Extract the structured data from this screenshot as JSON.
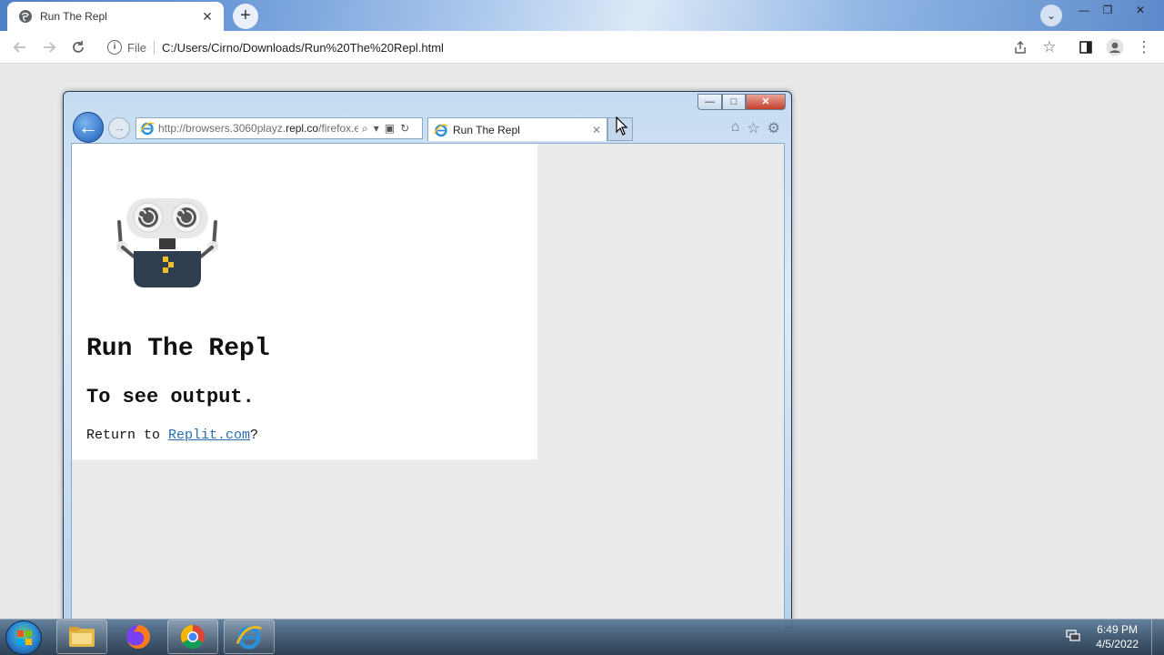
{
  "chrome": {
    "tab_title": "Run The Repl",
    "tab_close": "✕",
    "new_tab": "+",
    "scheme_label": "File",
    "url": "C:/Users/Cirno/Downloads/Run%20The%20Repl.html"
  },
  "ie": {
    "url_prefix": "http://browsers.3060playz.",
    "url_domain": "repl.co",
    "url_suffix": "/firefox.e",
    "tab_title": "Run The Repl",
    "tab_close": "✕",
    "close_glyph": "✕",
    "min_glyph": "—",
    "max_glyph": "□"
  },
  "page": {
    "heading": "Run The Repl",
    "subheading": "To see output.",
    "return_text": "Return to ",
    "link_text": "Replit.com",
    "question": "?"
  },
  "taskbar": {
    "time": "6:49 PM",
    "date": "4/5/2022"
  },
  "icons": {
    "chrome_nav": [
      "back-arrow-icon",
      "forward-arrow-icon",
      "reload-icon"
    ],
    "chrome_right": [
      "share-icon",
      "star-icon",
      "side-panel-icon",
      "profile-icon",
      "menu-icon"
    ],
    "ie_right": [
      "home-icon",
      "favorites-star-icon",
      "gear-icon"
    ]
  }
}
